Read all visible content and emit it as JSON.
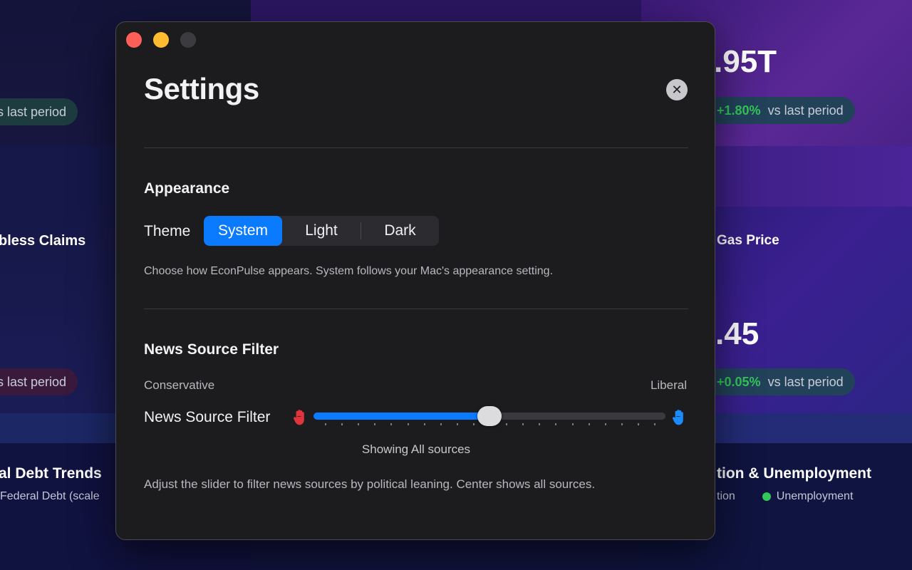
{
  "background": {
    "top_left_pill": "s last period",
    "top_right_value": ".95T",
    "top_right_change": "+1.80%",
    "top_right_pill_suffix": "vs last period",
    "left_card_title": "bless Claims",
    "left_card_pill": "s last period",
    "right_card_title": "Gas Price",
    "right_card_value": ".45",
    "right_card_change": "+0.05%",
    "right_card_pill_suffix": "vs last period",
    "bottom_left_title": "al Debt Trends",
    "bottom_left_legend": "Federal Debt (scale",
    "bottom_right_title": "tion & Unemployment",
    "bottom_right_legend_1": "tion",
    "bottom_right_legend_2": "Unemployment"
  },
  "window": {
    "title": "Settings",
    "close_icon": "close-icon",
    "appearance": {
      "section_title": "Appearance",
      "theme_label": "Theme",
      "theme_options": [
        "System",
        "Light",
        "Dark"
      ],
      "selected": "System",
      "help": "Choose how EconPulse appears. System follows your Mac's appearance setting."
    },
    "news_filter": {
      "section_title": "News Source Filter",
      "left_label": "Conservative",
      "right_label": "Liberal",
      "row_label": "News Source Filter",
      "slider_value": 0.5,
      "status": "Showing All sources",
      "help": "Adjust the slider to filter news sources by political leaning. Center shows all sources."
    }
  },
  "colors": {
    "accent": "#0a7aff",
    "conservative": "#e0353c",
    "liberal": "#1a8cff",
    "positive": "#34c759"
  }
}
